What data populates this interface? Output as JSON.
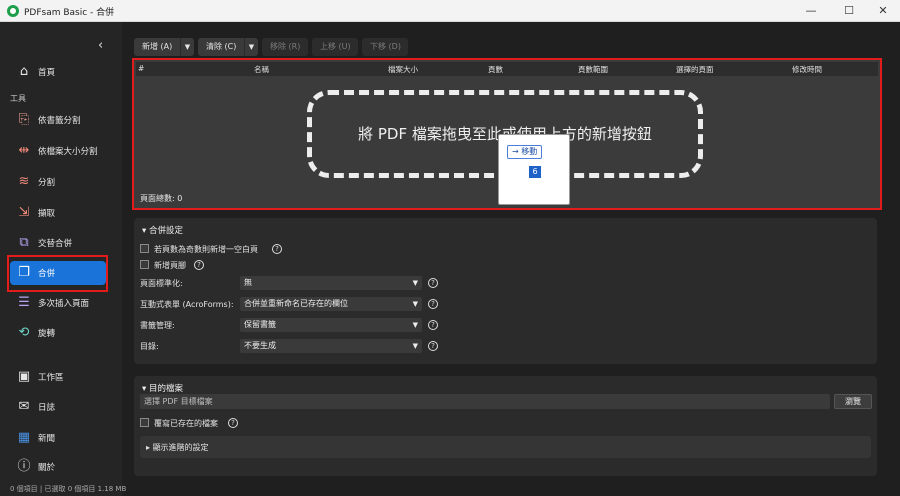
{
  "window": {
    "title": "PDFsam Basic - 合併",
    "minimize": "—",
    "maximize": "☐",
    "close": "✕"
  },
  "sidebar": {
    "collapse": "‹",
    "home": {
      "label": "首頁",
      "icon": "home-icon"
    },
    "tools_label": "工具",
    "items": [
      {
        "label": "依書籤分割",
        "icon": "bookmark-split-icon"
      },
      {
        "label": "依檔案大小分割",
        "icon": "size-split-icon"
      },
      {
        "label": "分割",
        "icon": "split-icon"
      },
      {
        "label": "擷取",
        "icon": "extract-icon"
      },
      {
        "label": "交替合併",
        "icon": "alternate-mix-icon"
      },
      {
        "label": "合併",
        "icon": "merge-icon",
        "active": true
      },
      {
        "label": "多次插入頁面",
        "icon": "insert-icon"
      },
      {
        "label": "旋轉",
        "icon": "rotate-icon"
      }
    ],
    "bottom": [
      {
        "label": "工作區",
        "icon": "workspace-icon"
      },
      {
        "label": "日誌",
        "icon": "log-icon"
      },
      {
        "label": "新聞",
        "icon": "news-icon"
      },
      {
        "label": "關於",
        "icon": "about-icon"
      }
    ]
  },
  "toolbar": {
    "add": "新增 (A)",
    "clear": "清除 (C)",
    "remove": "移除 (R)",
    "move_up": "上移 (U)",
    "move_down": "下移 (D)"
  },
  "table": {
    "columns": [
      "#",
      "名稱",
      "檔案大小",
      "頁數",
      "頁數範圍",
      "選擇的頁面",
      "修改時間"
    ],
    "drop_hint": "將 PDF 檔案拖曳至此或使用上方的新增按鈕",
    "total_pages": "頁面總數: 0"
  },
  "tooltip": {
    "move": "→ 移動",
    "count": "6"
  },
  "merge_settings": {
    "title": "合併設定",
    "blank_page": "若頁數為奇數則新增一空白頁",
    "add_footer": "新增頁腳",
    "normalize_label": "頁面標準化:",
    "normalize_value": "無",
    "forms_label": "互動式表單 (AcroForms):",
    "forms_value": "合併並重新命名已存在的欄位",
    "bookmarks_label": "書籤管理:",
    "bookmarks_value": "保留書籤",
    "toc_label": "目錄:",
    "toc_value": "不要生成"
  },
  "destination": {
    "title": "目的檔案",
    "placeholder": "選擇 PDF 目標檔案",
    "browse": "瀏覽",
    "overwrite": "覆寫已存在的檔案",
    "advanced": "顯示進階的設定"
  },
  "status": {
    "text": "0 個項目 | 已選取 0 個項目 1.18 MB"
  },
  "colors": {
    "accent": "#1a73d9",
    "highlight": "#e21b1b"
  }
}
